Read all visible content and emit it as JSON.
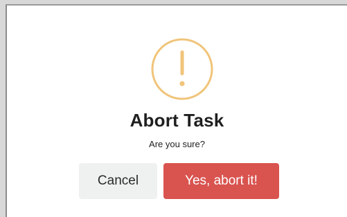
{
  "dialog": {
    "title": "Abort Task",
    "message": "Are you sure?",
    "icon": "warning-exclamation-icon",
    "icon_color": "#f0c47a"
  },
  "buttons": {
    "cancel_label": "Cancel",
    "confirm_label": "Yes, abort it!",
    "confirm_color": "#d9534f",
    "cancel_color": "#eff1f1"
  }
}
